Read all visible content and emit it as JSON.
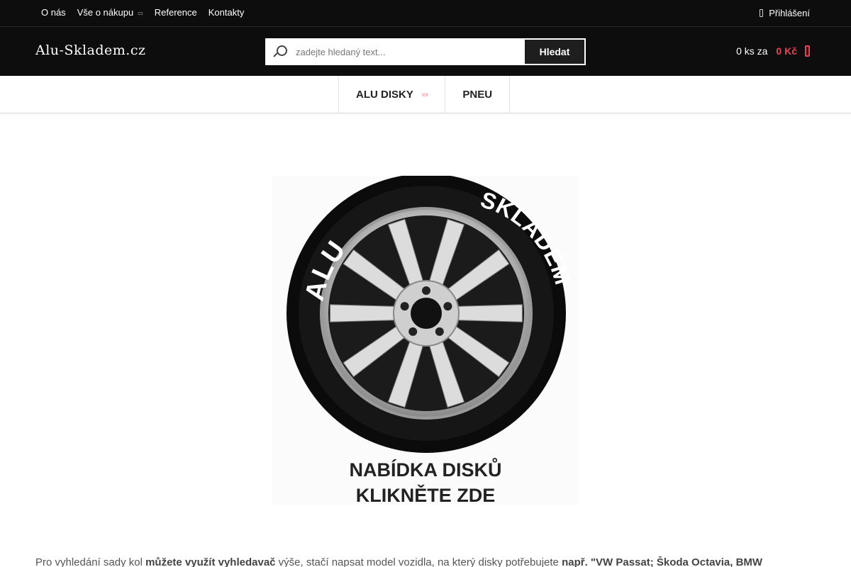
{
  "topnav": {
    "items": [
      {
        "label": "O nás"
      },
      {
        "label": "Vše o nákupu",
        "caret": "▭"
      },
      {
        "label": "Reference"
      },
      {
        "label": "Kontakty"
      }
    ],
    "login_label": "Přihlášení"
  },
  "header": {
    "logo_text": "Alu-Skladem.cz",
    "search": {
      "placeholder": "zadejte hledaný text...",
      "button_label": "Hledat"
    },
    "cart": {
      "count_text": "0 ks za",
      "price_text": "0 Kč"
    }
  },
  "mainnav": {
    "items": [
      {
        "label": "ALU DISKY",
        "caret": "▭"
      },
      {
        "label": "PNEU"
      }
    ]
  },
  "banner": {
    "tire_text_left": "ALU",
    "tire_text_right": "SKLADEM",
    "line1": "NABÍDKA DISKŮ",
    "line2": "KLIKNĚTE ZDE"
  },
  "description": {
    "part1": "Pro vyhledání sady kol ",
    "bold1": "můžete využít vyhledavač",
    "part2": " výše, stačí napsat model vozidla, na který disky potřebujete ",
    "bold2": "např. \"VW Passat; Škoda Octavia, BMW"
  },
  "colors": {
    "topbar_bg": "#0d0d0d",
    "accent": "#e8435a",
    "search_button_bg": "#1e1e1e"
  }
}
